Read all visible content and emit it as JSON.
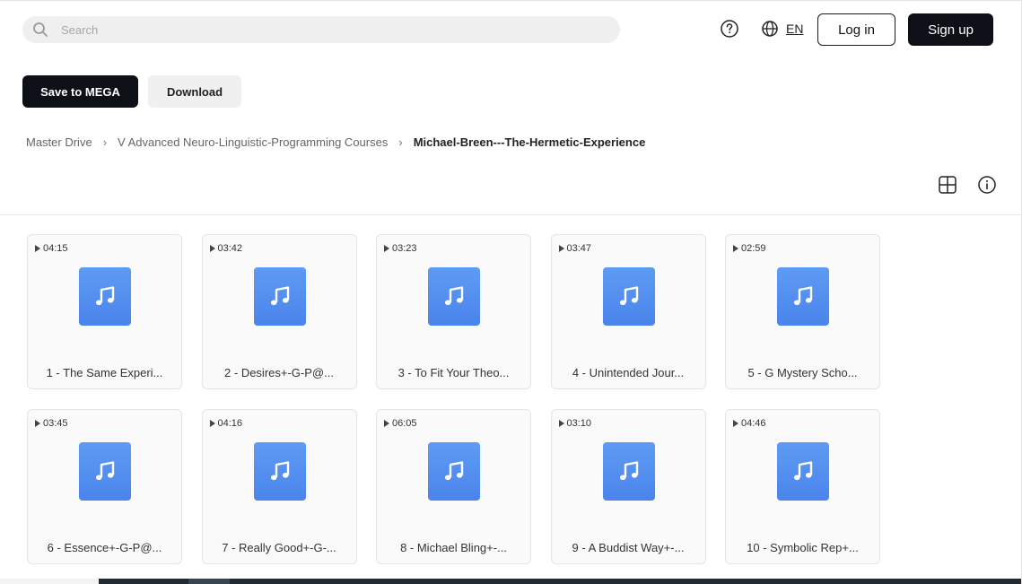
{
  "header": {
    "search_placeholder": "Search",
    "language": "EN",
    "login_label": "Log in",
    "signup_label": "Sign up"
  },
  "actions": {
    "save_label": "Save to MEGA",
    "download_label": "Download"
  },
  "breadcrumb": {
    "items": [
      "Master Drive",
      "V Advanced Neuro-Linguistic-Programming Courses"
    ],
    "current": "Michael-Breen---The-Hermetic-Experience"
  },
  "colors": {
    "primary_dark": "#0d1117",
    "audio_icon": "#4a84ec"
  },
  "files": [
    {
      "duration": "04:15",
      "name": "1 - The Same Experi..."
    },
    {
      "duration": "03:42",
      "name": "2 - Desires+-G-P@..."
    },
    {
      "duration": "03:23",
      "name": "3 - To Fit Your Theo..."
    },
    {
      "duration": "03:47",
      "name": "4 - Unintended Jour..."
    },
    {
      "duration": "02:59",
      "name": "5 - G Mystery Scho..."
    },
    {
      "duration": "03:45",
      "name": "6 - Essence+-G-P@..."
    },
    {
      "duration": "04:16",
      "name": "7 - Really Good+-G-..."
    },
    {
      "duration": "06:05",
      "name": "8 - Michael Bling+-..."
    },
    {
      "duration": "03:10",
      "name": "9 - A Buddist Way+-..."
    },
    {
      "duration": "04:46",
      "name": "10 - Symbolic Rep+..."
    }
  ]
}
